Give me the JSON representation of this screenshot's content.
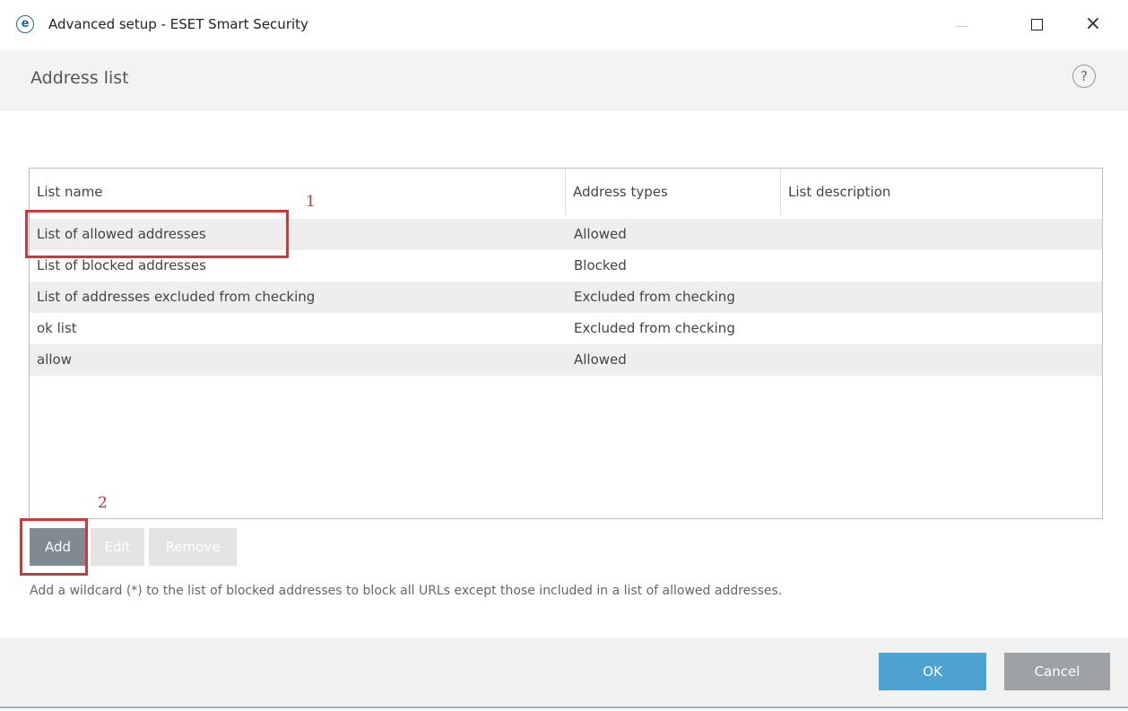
{
  "window": {
    "logo_glyph": "e",
    "title": "Advanced setup - ESET Smart Security",
    "close_glyph": "×"
  },
  "header": {
    "title": "Address list",
    "help_glyph": "?"
  },
  "table": {
    "columns": [
      "List name",
      "Address types",
      "List description"
    ],
    "rows": [
      {
        "name": "List of allowed addresses",
        "type": "Allowed",
        "description": ""
      },
      {
        "name": "List of blocked addresses",
        "type": "Blocked",
        "description": ""
      },
      {
        "name": "List of addresses excluded from checking",
        "type": "Excluded from checking",
        "description": ""
      },
      {
        "name": "ok list",
        "type": "Excluded from checking",
        "description": ""
      },
      {
        "name": "allow",
        "type": "Allowed",
        "description": ""
      }
    ]
  },
  "actions": {
    "add": "Add",
    "edit": "Edit",
    "remove": "Remove"
  },
  "hint": "Add a wildcard (*) to the list of blocked addresses to block all URLs except those included in a list of allowed addresses.",
  "footer": {
    "ok": "OK",
    "cancel": "Cancel"
  },
  "annotations": {
    "marker_1": "1",
    "marker_2": "2"
  },
  "colors": {
    "accent": "#4fa3d1",
    "callout": "#c93b3b"
  }
}
